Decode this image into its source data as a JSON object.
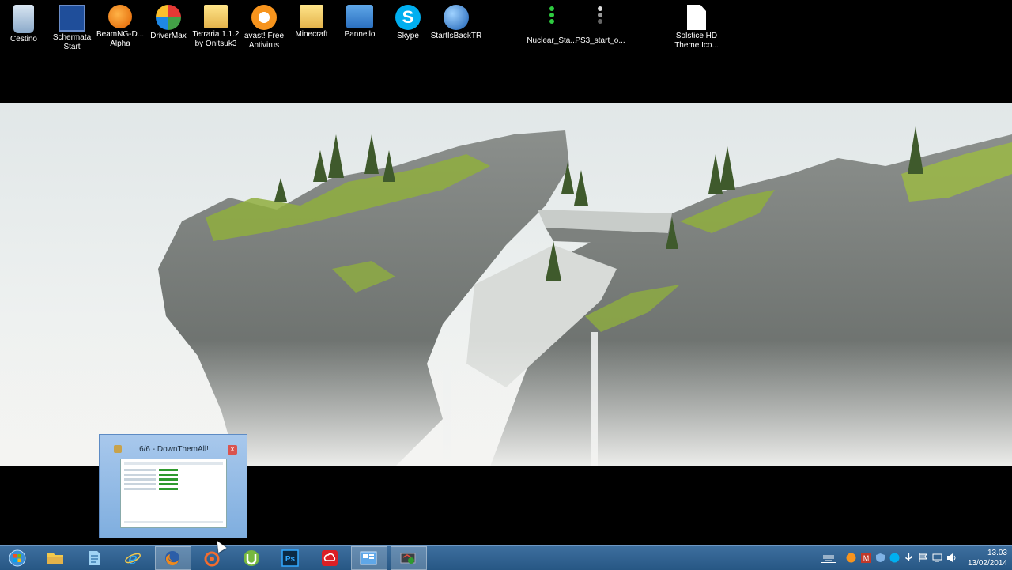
{
  "desktop": {
    "icons": [
      {
        "label_1": "Cestino",
        "label_2": "",
        "icon": "recycle-bin-icon"
      },
      {
        "label_1": "Schermata",
        "label_2": "Start",
        "icon": "start-screen-icon"
      },
      {
        "label_1": "BeamNG-D...",
        "label_2": "Alpha",
        "icon": "beamng-icon"
      },
      {
        "label_1": "DriverMax",
        "label_2": "",
        "icon": "drivermax-icon"
      },
      {
        "label_1": "Terraria 1.1.2",
        "label_2": "by Onitsuk3",
        "icon": "folder-icon"
      },
      {
        "label_1": "avast! Free",
        "label_2": "Antivirus",
        "icon": "avast-icon"
      },
      {
        "label_1": "Minecraft",
        "label_2": "",
        "icon": "folder-icon"
      },
      {
        "label_1": "Pannello",
        "label_2": "",
        "icon": "control-panel-icon"
      },
      {
        "label_1": "Skype",
        "label_2": "",
        "icon": "skype-icon"
      },
      {
        "label_1": "StartIsBackTR",
        "label_2": "",
        "icon": "startisback-icon"
      },
      {
        "label_1": "Nuclear_Sta...",
        "label_2": "",
        "icon": "status-light-green-icon"
      },
      {
        "label_1": "PS3_start_o...",
        "label_2": "",
        "icon": "status-light-grey-icon"
      },
      {
        "label_1": "Solstice HD",
        "label_2": "Theme Ico...",
        "icon": "file-icon"
      }
    ]
  },
  "preview": {
    "title": "6/6 - DownThemAll!",
    "close_glyph": "x"
  },
  "taskbar": {
    "apps": [
      {
        "name": "start-orb",
        "icon": "windows-orb-icon"
      },
      {
        "name": "file-explorer",
        "icon": "folder-icon"
      },
      {
        "name": "notepad",
        "icon": "notepad-icon"
      },
      {
        "name": "internet-explorer",
        "icon": "ie-icon"
      },
      {
        "name": "firefox",
        "icon": "firefox-icon"
      },
      {
        "name": "origin",
        "icon": "origin-icon"
      },
      {
        "name": "utorrent",
        "icon": "utorrent-icon"
      },
      {
        "name": "photoshop",
        "icon": "photoshop-icon"
      },
      {
        "name": "creative-cloud",
        "icon": "creative-cloud-icon"
      },
      {
        "name": "control-panel",
        "icon": "control-panel-icon"
      },
      {
        "name": "network-tool",
        "icon": "network-icon"
      }
    ],
    "photoshop_label": "Ps",
    "clock": {
      "time": "13.03",
      "date": "13/02/2014"
    }
  },
  "colors": {
    "taskbar": "#2d5f8f",
    "accent": "#7faedf"
  }
}
